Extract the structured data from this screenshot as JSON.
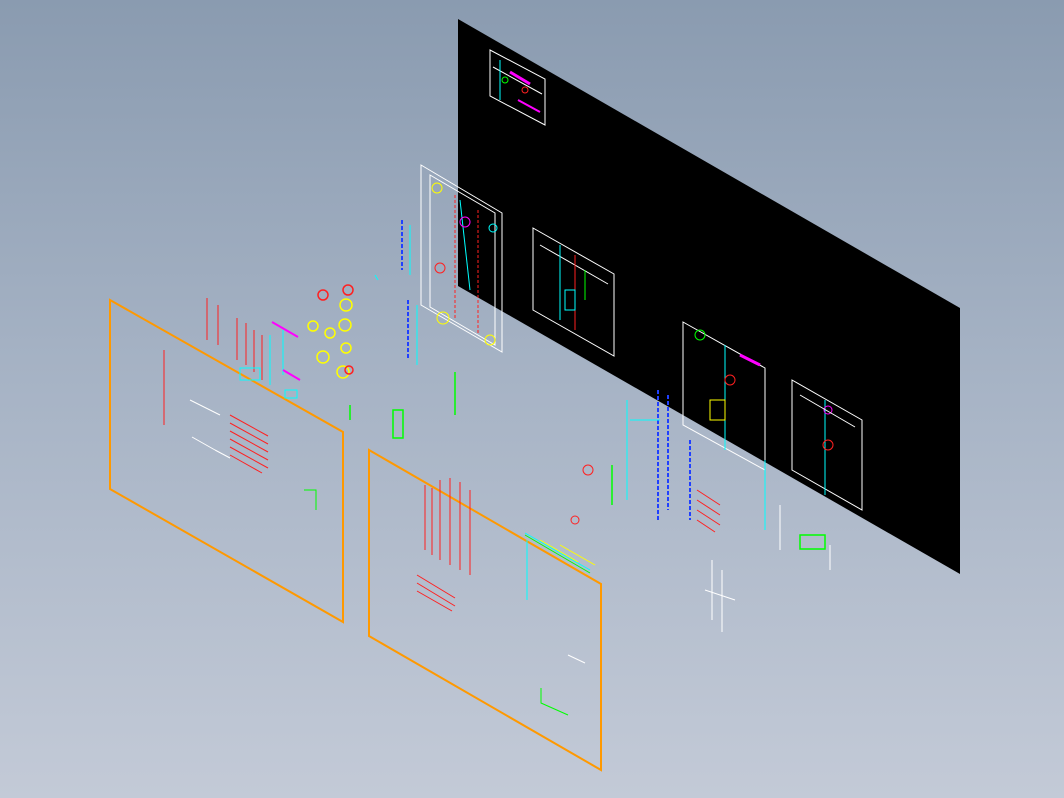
{
  "viewport": {
    "background_top": "#8a9bb0",
    "background_bottom": "#c3cad7",
    "view": "isometric-3d"
  },
  "cad_colors": {
    "sheet_border": "#ff9900",
    "red": "#ff2020",
    "yellow": "#ffff00",
    "green": "#00ff00",
    "cyan": "#00ffff",
    "blue": "#2040ff",
    "magenta": "#ff00ff",
    "white": "#ffffff",
    "black_panel": "#000000"
  },
  "layers": [
    {
      "name": "black-drawing-panel",
      "fill": "#000000"
    },
    {
      "name": "drawing-sheet-left",
      "border": "#ff9900"
    },
    {
      "name": "drawing-sheet-center",
      "border": "#ff9900"
    },
    {
      "name": "exploded-mold-parts",
      "colors": [
        "#ff2020",
        "#00ffff",
        "#00ff00",
        "#ff00ff",
        "#ffff00",
        "#2040ff",
        "#ffffff"
      ]
    }
  ]
}
